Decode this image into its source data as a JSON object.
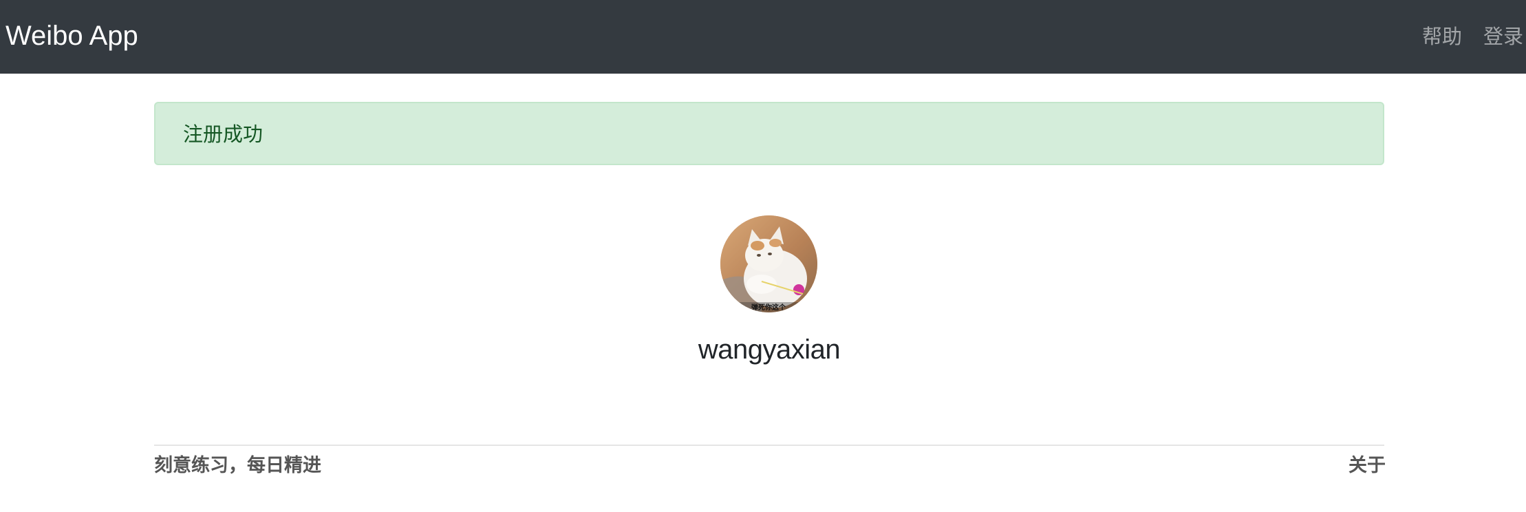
{
  "navbar": {
    "brand": "Weibo App",
    "links": [
      {
        "label": "帮助"
      },
      {
        "label": "登录"
      }
    ],
    "background": "#343a40"
  },
  "alert": {
    "type": "success",
    "message": "注册成功",
    "background": "#d4edda",
    "text_color": "#155724"
  },
  "profile": {
    "avatar_icon": "user-avatar-cat-photo",
    "avatar_caption": "弹死你这个",
    "username": "wangyaxian"
  },
  "footer": {
    "slogan": "刻意练习，每日精进",
    "about_label": "关于"
  }
}
